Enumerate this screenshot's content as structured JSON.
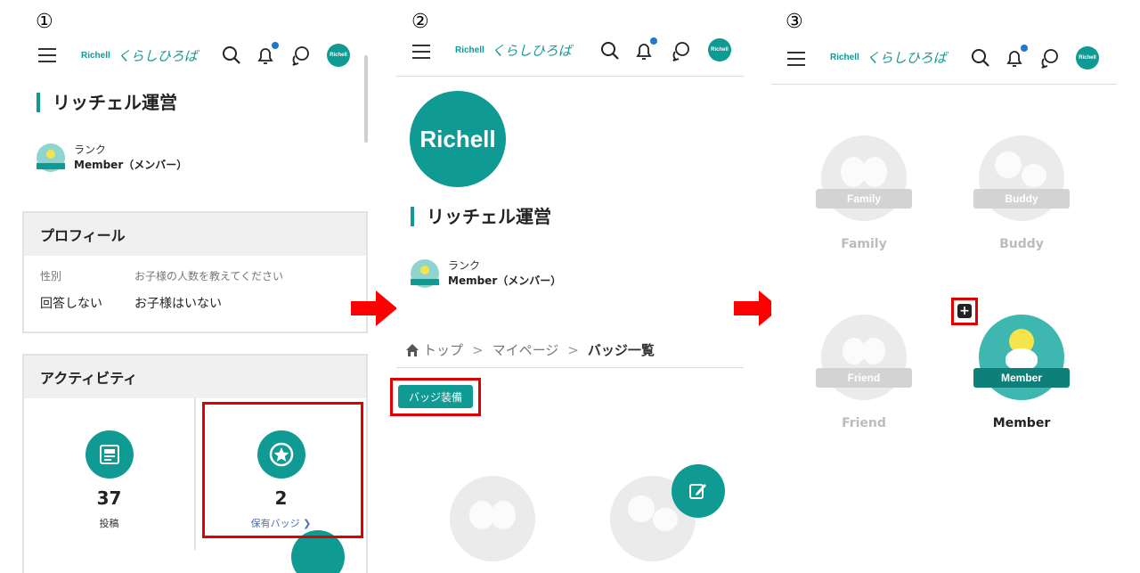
{
  "steps": [
    "①",
    "②",
    "③"
  ],
  "header": {
    "brand_en": "Richell",
    "brand_jp": "くらしひろば",
    "avatar_text": "Richell"
  },
  "profile": {
    "name": "リッチェル運営",
    "rank_label": "ランク",
    "rank_value": "Member（メンバー）",
    "avatar_text": "Richell"
  },
  "profile_card": {
    "title": "プロフィール",
    "gender_label": "性別",
    "gender_value": "回答しない",
    "children_label": "お子様の人数を教えてください",
    "children_value": "お子様はいない"
  },
  "activity_card": {
    "title": "アクティビティ",
    "posts_count": "37",
    "posts_label": "投稿",
    "badges_count": "2",
    "badges_link": "保有バッジ ❯"
  },
  "breadcrumb": {
    "top": "トップ",
    "sep": ">",
    "mypage": "マイページ",
    "current": "バッジ一覧"
  },
  "equip_button": "バッジ装備",
  "badges": [
    {
      "ribbon": "Family",
      "name": "Family",
      "state": "locked"
    },
    {
      "ribbon": "Buddy",
      "name": "Buddy",
      "state": "locked"
    },
    {
      "ribbon": "Friend",
      "name": "Friend",
      "state": "locked"
    },
    {
      "ribbon": "Member",
      "name": "Member",
      "state": "owned"
    }
  ],
  "plus_glyph": "+",
  "colors": {
    "accent": "#0f9a93",
    "highlight": "#e00000",
    "notification": "#1e79c8"
  }
}
